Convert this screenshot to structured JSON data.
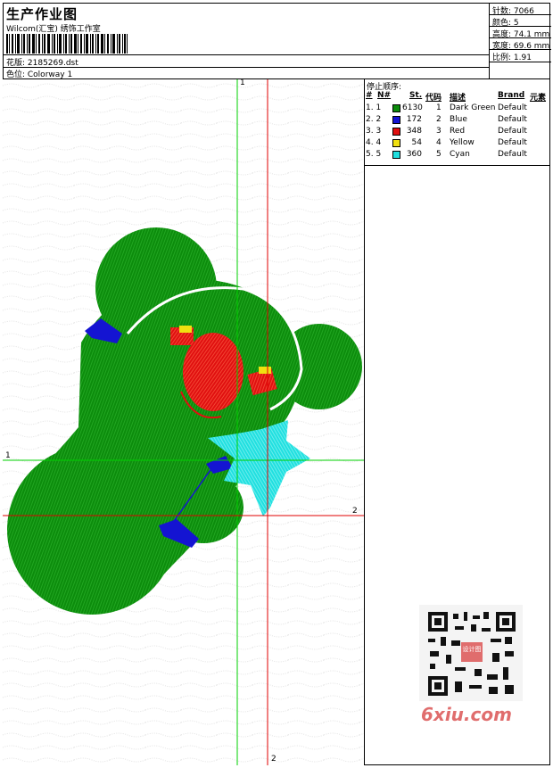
{
  "header": {
    "title": "生产作业图",
    "company": "Wilcom(汇宝) 绣饰工作室",
    "design_file": "花版: 2185269.dst",
    "colorway": "色位: Colorway 1"
  },
  "specs": {
    "stitches": "针数: 7066",
    "colors": "颜色: 5",
    "height": "高度: 74.1 mm",
    "width": "宽度: 69.6 mm",
    "scale": "比例: 1.91"
  },
  "stop_sequence": {
    "title": "停止顺序:",
    "headers": {
      "hash": "#",
      "n": "N#",
      "st": "St.",
      "code": "代码",
      "desc": "描述",
      "brand": "Brand",
      "element": "元素"
    },
    "rows": [
      {
        "hash": "1. 1",
        "stitches": "6130",
        "code": "1",
        "desc": "Dark Green",
        "brand": "Default",
        "color": "#0c8c0c"
      },
      {
        "hash": "2. 2",
        "stitches": "172",
        "code": "2",
        "desc": "Blue",
        "brand": "Default",
        "color": "#1414d2"
      },
      {
        "hash": "3. 3",
        "stitches": "348",
        "code": "3",
        "desc": "Red",
        "brand": "Default",
        "color": "#e01010"
      },
      {
        "hash": "4. 4",
        "stitches": "54",
        "code": "4",
        "desc": "Yellow",
        "brand": "Default",
        "color": "#f0e010"
      },
      {
        "hash": "5. 5",
        "stitches": "360",
        "code": "5",
        "desc": "Cyan",
        "brand": "Default",
        "color": "#20e0e0"
      }
    ]
  },
  "axes": {
    "green_top": "1",
    "green_left": "1",
    "red_right": "2",
    "red_bottom": "2"
  },
  "watermark": "6xiu.com",
  "qr_badge": "设计图"
}
